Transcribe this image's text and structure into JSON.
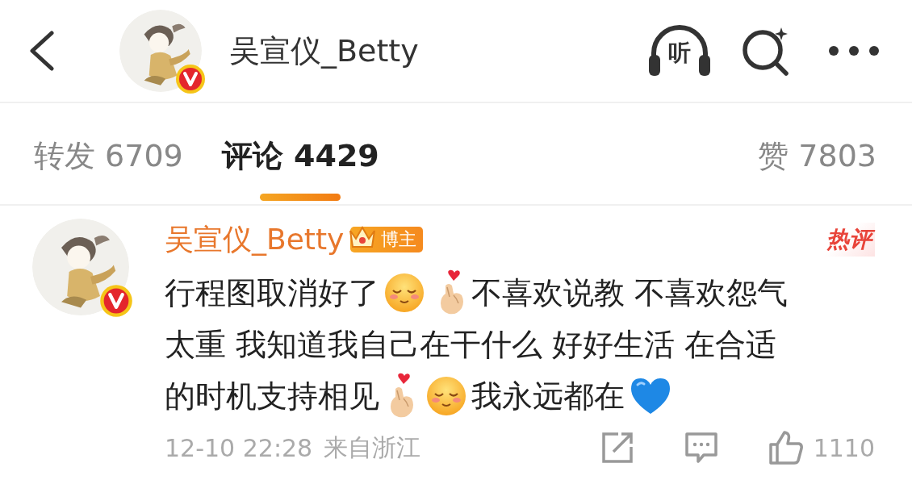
{
  "header": {
    "title": "吴宣仪_Betty",
    "listen_label": "听"
  },
  "tabs": [
    {
      "label": "转发 6709",
      "selected": false
    },
    {
      "label": "评论 4429",
      "selected": true
    },
    {
      "label": "赞 7803",
      "selected": false
    }
  ],
  "comment": {
    "author": "吴宣仪_Betty",
    "author_badge": "博主",
    "hot_label": "热评",
    "lines": [
      [
        {
          "kind": "text",
          "text": "行程图取消好了"
        },
        {
          "kind": "smile"
        },
        {
          "kind": "fingerheart"
        },
        {
          "kind": "text",
          "text": "不喜欢说教 不喜欢怨气"
        }
      ],
      [
        {
          "kind": "text",
          "text": "太重 我知道我自己在干什么 好好生活 在合适"
        }
      ],
      [
        {
          "kind": "text",
          "text": "的时机支持相见"
        },
        {
          "kind": "fingerheart"
        },
        {
          "kind": "smile"
        },
        {
          "kind": "text",
          "text": "我永远都在"
        },
        {
          "kind": "blueheart"
        }
      ]
    ],
    "time": "12-10 22:28",
    "location": "来自浙江",
    "likes": "1110"
  }
}
